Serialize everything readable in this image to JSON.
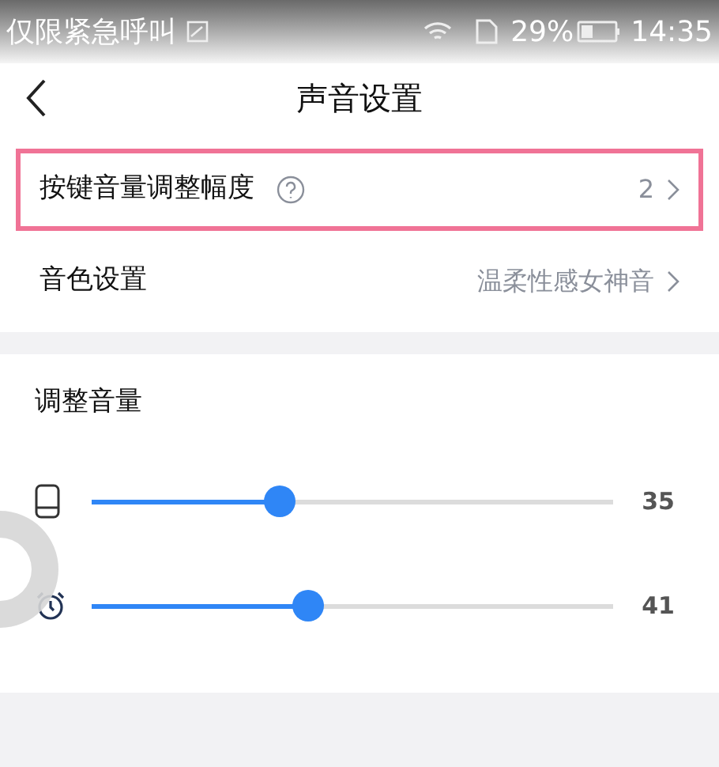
{
  "status_bar": {
    "carrier": "仅限紧急呼叫",
    "battery": "29%",
    "time": "14:35"
  },
  "header": {
    "title": "声音设置"
  },
  "settings": [
    {
      "label": "按键音量调整幅度",
      "help": true,
      "value": "2",
      "highlighted": true
    },
    {
      "label": "音色设置",
      "help": false,
      "value": "温柔性感女神音",
      "highlighted": false
    }
  ],
  "volume_section": {
    "title": "调整音量",
    "sliders": [
      {
        "kind": "phone",
        "level": 0.36,
        "reading": "35"
      },
      {
        "kind": "alarm",
        "level": 0.415,
        "reading": "41"
      }
    ]
  }
}
